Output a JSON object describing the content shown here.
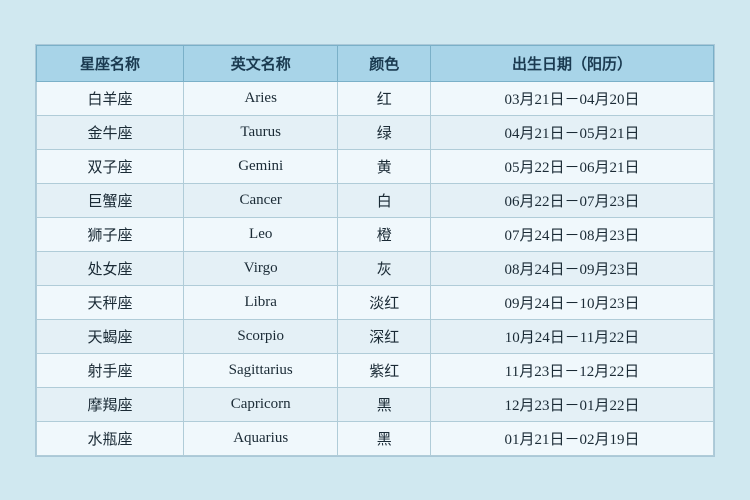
{
  "table": {
    "headers": [
      "星座名称",
      "英文名称",
      "颜色",
      "出生日期（阳历）"
    ],
    "rows": [
      {
        "chinese": "白羊座",
        "english": "Aries",
        "color": "红",
        "dates": "03月21日－04月20日"
      },
      {
        "chinese": "金牛座",
        "english": "Taurus",
        "color": "绿",
        "dates": "04月21日－05月21日"
      },
      {
        "chinese": "双子座",
        "english": "Gemini",
        "color": "黄",
        "dates": "05月22日－06月21日"
      },
      {
        "chinese": "巨蟹座",
        "english": "Cancer",
        "color": "白",
        "dates": "06月22日－07月23日"
      },
      {
        "chinese": "狮子座",
        "english": "Leo",
        "color": "橙",
        "dates": "07月24日－08月23日"
      },
      {
        "chinese": "处女座",
        "english": "Virgo",
        "color": "灰",
        "dates": "08月24日－09月23日"
      },
      {
        "chinese": "天秤座",
        "english": "Libra",
        "color": "淡红",
        "dates": "09月24日－10月23日"
      },
      {
        "chinese": "天蝎座",
        "english": "Scorpio",
        "color": "深红",
        "dates": "10月24日－11月22日"
      },
      {
        "chinese": "射手座",
        "english": "Sagittarius",
        "color": "紫红",
        "dates": "11月23日－12月22日"
      },
      {
        "chinese": "摩羯座",
        "english": "Capricorn",
        "color": "黑",
        "dates": "12月23日－01月22日"
      },
      {
        "chinese": "水瓶座",
        "english": "Aquarius",
        "color": "黑",
        "dates": "01月21日－02月19日"
      }
    ]
  }
}
